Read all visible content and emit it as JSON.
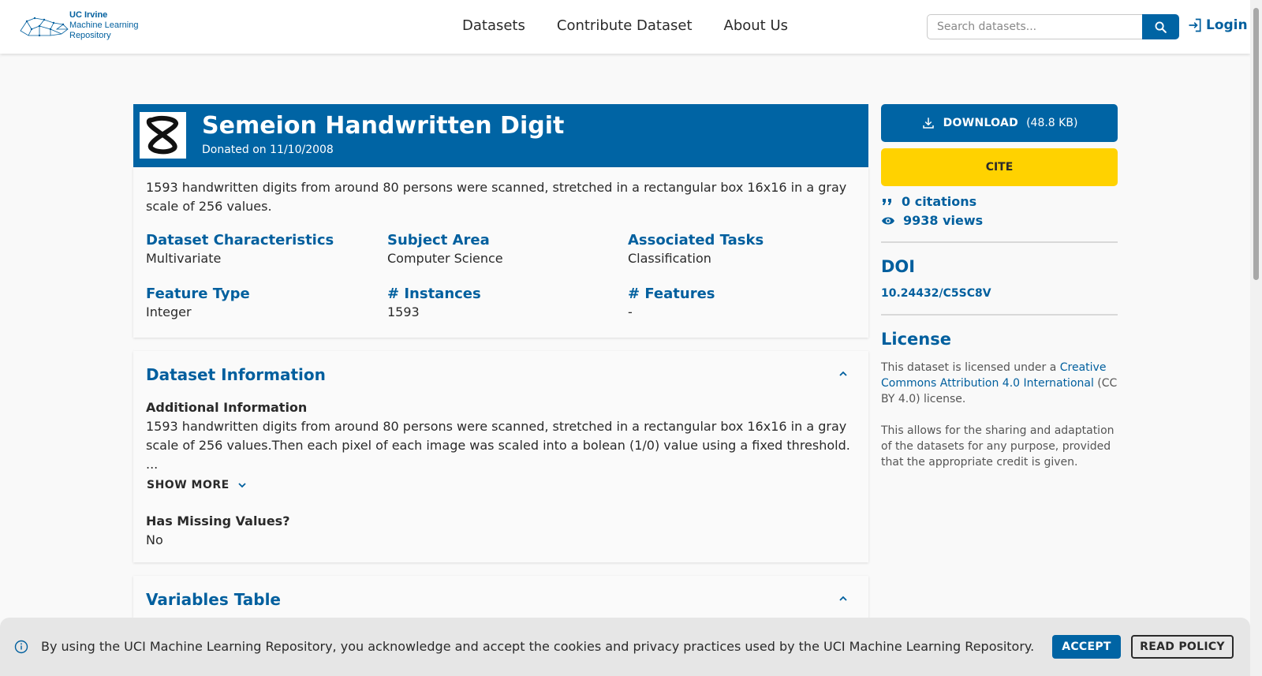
{
  "header": {
    "logo": {
      "line1": "UC Irvine",
      "line2": "Machine Learning",
      "line3": "Repository"
    },
    "nav": [
      "Datasets",
      "Contribute Dataset",
      "About Us"
    ],
    "search_placeholder": "Search datasets...",
    "login_label": "Login"
  },
  "dataset": {
    "title": "Semeion Handwritten Digit",
    "donated": "Donated on 11/10/2008",
    "summary": "1593 handwritten digits from around 80 persons were scanned, stretched in a rectangular box 16x16 in a gray scale of 256 values.",
    "meta": [
      {
        "key": "Dataset Characteristics",
        "value": "Multivariate"
      },
      {
        "key": "Subject Area",
        "value": "Computer Science"
      },
      {
        "key": "Associated Tasks",
        "value": "Classification"
      },
      {
        "key": "Feature Type",
        "value": "Integer"
      },
      {
        "key": "# Instances",
        "value": "1593"
      },
      {
        "key": "# Features",
        "value": "-"
      }
    ]
  },
  "info": {
    "section_title": "Dataset Information",
    "additional_heading": "Additional Information",
    "additional_text": "1593 handwritten digits from around 80 persons were scanned, stretched in a rectangular box 16x16 in a gray scale of 256 values.Then each pixel of each image was scaled into a bolean (1/0) value using a fixed threshold.",
    "ellipsis": "...",
    "show_more": "SHOW MORE",
    "missing_heading": "Has Missing Values?",
    "missing_value": "No"
  },
  "variables": {
    "section_title": "Variables Table"
  },
  "sidebar": {
    "download_label": "DOWNLOAD",
    "download_size": "(48.8 KB)",
    "cite_label": "CITE",
    "citations": "0 citations",
    "views": "9938 views",
    "doi_heading": "DOI",
    "doi": "10.24432/C5SC8V",
    "license_heading": "License",
    "license_prefix": "This dataset is licensed under a ",
    "license_link": "Creative Commons Attribution 4.0 International",
    "license_suffix": " (CC BY 4.0) license.",
    "license_note": "This allows for the sharing and adaptation of the datasets for any purpose, provided that the appropriate credit is given."
  },
  "cookie": {
    "text": "By using the UCI Machine Learning Repository, you acknowledge and accept the cookies and privacy practices used by the UCI Machine Learning Repository.",
    "accept": "ACCEPT",
    "read_policy": "READ POLICY"
  },
  "colors": {
    "primary": "#0064a4",
    "accent": "#ffd200",
    "background": "#f9f9f9"
  }
}
